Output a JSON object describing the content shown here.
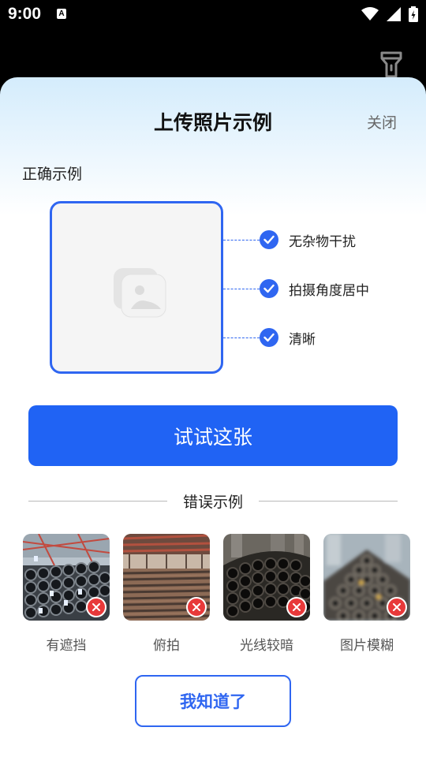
{
  "status_bar": {
    "time": "9:00",
    "app_icon_letter": "A"
  },
  "dialog": {
    "title": "上传照片示例",
    "close_label": "关闭",
    "correct_section_title": "正确示例",
    "checks": [
      "无杂物干扰",
      "拍摄角度居中",
      "清晰"
    ],
    "try_button_label": "试试这张",
    "wrong_section_title": "错误示例",
    "wrong_examples": [
      {
        "label": "有遮挡"
      },
      {
        "label": "俯拍"
      },
      {
        "label": "光线较暗"
      },
      {
        "label": "图片模糊"
      }
    ],
    "confirm_button_label": "我知道了"
  },
  "colors": {
    "accent": "#2063f4",
    "error": "#e8393a",
    "sheet_top": "#d4ecfc"
  }
}
